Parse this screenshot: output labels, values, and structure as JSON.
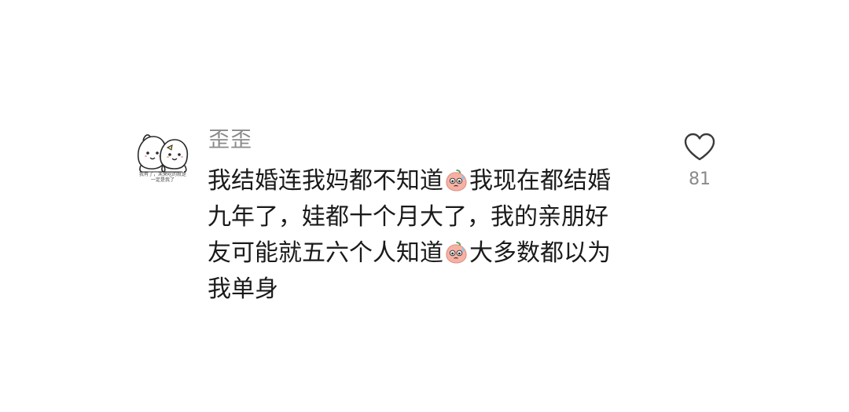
{
  "comment": {
    "username": "歪歪",
    "avatar_text": "我有了，未来吃的就是一定是我了",
    "lines": [
      [
        "我结婚连我妈都不知道",
        "emoji",
        "我现在都结婚"
      ],
      [
        "九年了，娃都十个月大了，我的亲朋好"
      ],
      [
        "友可能就五六个人知道",
        "emoji",
        "大多数都以为"
      ],
      [
        "我单身"
      ]
    ],
    "emoji_name": "sweat-peach-emoji",
    "like": {
      "icon": "heart-outline-icon",
      "count": "81"
    }
  }
}
